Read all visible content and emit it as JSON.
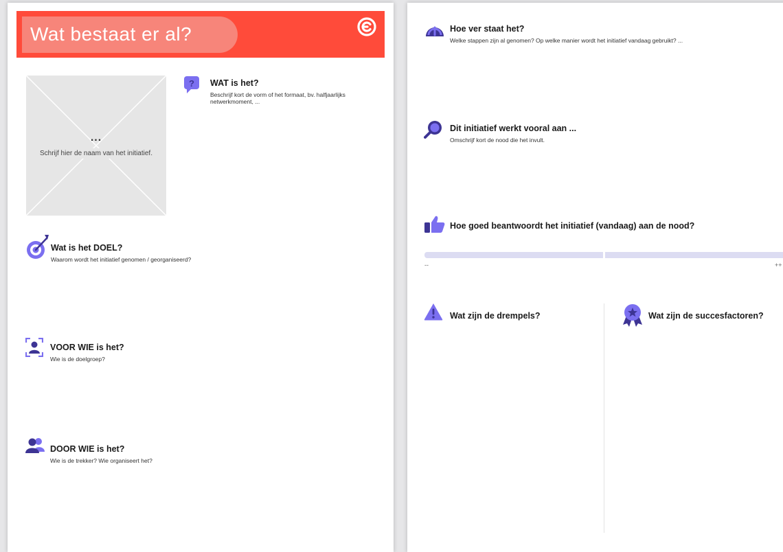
{
  "header": {
    "title": "Wat bestaat er al?"
  },
  "placeholder": {
    "dots": "...",
    "text": "Schrijf hier de naam van het initiatief."
  },
  "left_blocks": {
    "wat": {
      "title": "WAT is het?",
      "desc": "Beschrijf kort de vorm of het formaat, bv. halfjaarlijks netwerkmoment, ..."
    },
    "doel": {
      "title": "Wat is het DOEL?",
      "desc": "Waarom wordt het initiatief genomen / georganiseerd?"
    },
    "voor_wie": {
      "title": "VOOR WIE is het?",
      "desc": "Wie is de doelgroep?"
    },
    "door_wie": {
      "title": "DOOR WIE is het?",
      "desc": "Wie is de trekker? Wie organiseert het?"
    }
  },
  "right_blocks": {
    "hoe_ver": {
      "title": "Hoe ver staat het?",
      "desc": "Welke stappen zijn al genomen? Op welke manier wordt het initiatief vandaag gebruikt? ..."
    },
    "werkt_aan": {
      "title": "Dit initiatief werkt vooral aan ...",
      "desc": "Omschrijf kort de nood die het invult."
    },
    "beantwoordt": {
      "title": "Hoe goed beantwoordt het initiatief (vandaag) aan de nood?"
    },
    "rating": {
      "min_label": "--",
      "max_label": "++"
    },
    "drempels": {
      "title": "Wat zijn de drempels?"
    },
    "succesfactoren": {
      "title": "Wat zijn de succesfactoren?"
    }
  },
  "colors": {
    "header_red": "#ff4b3a",
    "title_pill": "#f7857a",
    "icon_purple": "#7b6ff0",
    "icon_dark": "#3d3494"
  },
  "icons": [
    "logo-icon",
    "question-icon",
    "target-icon",
    "person-frame-icon",
    "people-icon",
    "gauge-icon",
    "magnifier-icon",
    "thumbs-up-icon",
    "warning-icon",
    "award-icon"
  ]
}
